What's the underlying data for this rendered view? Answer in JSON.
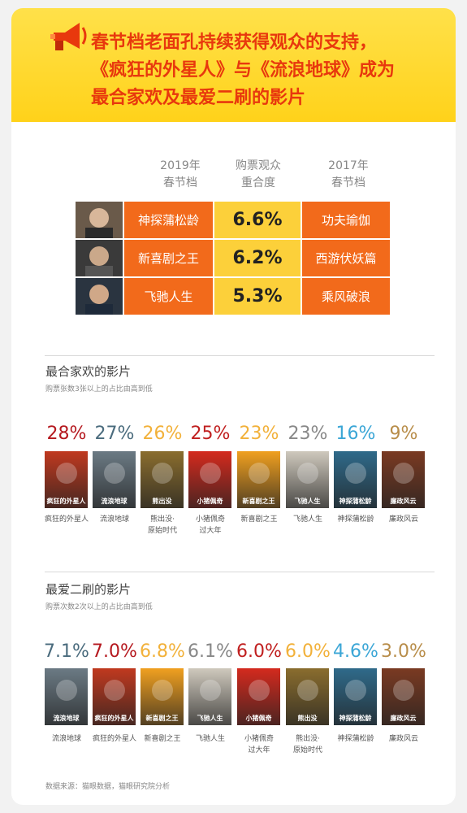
{
  "header": {
    "title_line1": "春节档老面孔持续获得观众的支持，",
    "title_line2": "《疯狂的外星人》与《流浪地球》成为",
    "title_line3": "最合家欢及最爱二刷的影片"
  },
  "comparison": {
    "col1_line1": "2019年",
    "col1_line2": "春节档",
    "col2_line1": "购票观众",
    "col2_line2": "重合度",
    "col3_line1": "2017年",
    "col3_line2": "春节档",
    "rows": [
      {
        "film_2019": "神探蒲松龄",
        "overlap": "6.6%",
        "film_2017": "功夫瑜伽"
      },
      {
        "film_2019": "新喜剧之王",
        "overlap": "6.2%",
        "film_2017": "西游伏妖篇"
      },
      {
        "film_2019": "飞驰人生",
        "overlap": "5.3%",
        "film_2017": "乘风破浪"
      }
    ]
  },
  "family": {
    "title": "最合家欢的影片",
    "subtitle": "购票张数3张以上的占比由高到低"
  },
  "repeat": {
    "title": "最爱二刷的影片",
    "subtitle": "购票次数2次以上的占比由高到低"
  },
  "footer": "数据来源：猫眼数据，猫眼研究院分析",
  "colors": {
    "orange": "#f26a1b",
    "yellow": "#fcd03a",
    "title_red": "#e8380d"
  },
  "chart_data": [
    {
      "type": "bar",
      "title": "最合家欢的影片",
      "categories": [
        "疯狂的外星人",
        "流浪地球",
        "熊出没·原始时代",
        "小猪佩奇过大年",
        "新喜剧之王",
        "飞驰人生",
        "神探蒲松龄",
        "廉政风云"
      ],
      "values": [
        28,
        27,
        26,
        25,
        23,
        23,
        16,
        9
      ],
      "value_labels": [
        "28%",
        "27%",
        "26%",
        "25%",
        "23%",
        "23%",
        "16%",
        "9%"
      ],
      "colors": [
        "#b5191f",
        "#4a6b7d",
        "#f2b13a",
        "#c01f1f",
        "#f2b13a",
        "#888888",
        "#3ba6d6",
        "#b88d4a"
      ]
    },
    {
      "type": "bar",
      "title": "最爱二刷的影片",
      "categories": [
        "流浪地球",
        "疯狂的外星人",
        "新喜剧之王",
        "飞驰人生",
        "小猪佩奇过大年",
        "熊出没·原始时代",
        "神探蒲松龄",
        "廉政风云"
      ],
      "values": [
        7.1,
        7.0,
        6.8,
        6.1,
        6.0,
        6.0,
        4.6,
        3.0
      ],
      "value_labels": [
        "7.1%",
        "7.0%",
        "6.8%",
        "6.1%",
        "6.0%",
        "6.0%",
        "4.6%",
        "3.0%"
      ],
      "colors": [
        "#4a6b7d",
        "#b5191f",
        "#f2b13a",
        "#888888",
        "#c01f1f",
        "#f2b13a",
        "#3ba6d6",
        "#b88d4a"
      ]
    }
  ],
  "posters": {
    "疯狂的外星人": {
      "text": "疯狂的外星人",
      "bg": "#c0391f"
    },
    "流浪地球": {
      "text": "流浪地球",
      "bg": "#6b7a84"
    },
    "熊出没·原始时代": {
      "text": "熊出没",
      "bg": "#8a6d2e"
    },
    "小猪佩奇过大年": {
      "text": "小猪佩奇",
      "bg": "#d42a1e"
    },
    "新喜剧之王": {
      "text": "新喜剧之王",
      "bg": "#f0a020"
    },
    "飞驰人生": {
      "text": "飞驰人生",
      "bg": "#cfc9bd"
    },
    "神探蒲松龄": {
      "text": "神探蒲松龄",
      "bg": "#2f6a8a"
    },
    "廉政风云": {
      "text": "廉政风云",
      "bg": "#7a3a22"
    }
  },
  "captions": {
    "疯狂的外星人": [
      "疯狂的外星人"
    ],
    "流浪地球": [
      "流浪地球"
    ],
    "熊出没·原始时代": [
      "熊出没·",
      "原始时代"
    ],
    "小猪佩奇过大年": [
      "小猪佩奇",
      "过大年"
    ],
    "新喜剧之王": [
      "新喜剧之王"
    ],
    "飞驰人生": [
      "飞驰人生"
    ],
    "神探蒲松龄": [
      "神探蒲松龄"
    ],
    "廉政风云": [
      "廉政风云"
    ]
  }
}
